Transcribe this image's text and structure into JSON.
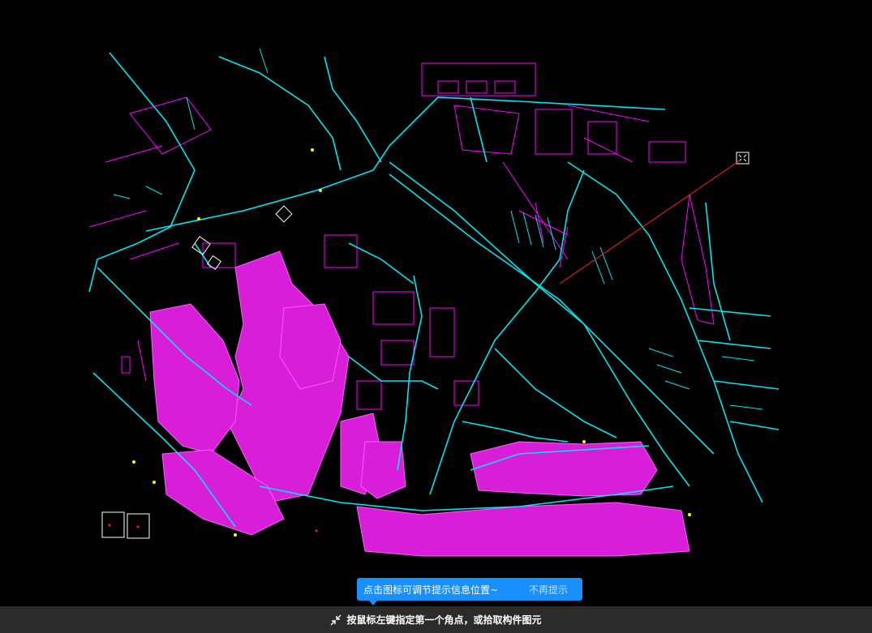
{
  "tooltip": {
    "message": "点击图标可调节提示信息位置~",
    "dismiss_label": "不再提示"
  },
  "status_bar": {
    "prompt": "按鼠标左键指定第一个角点，或拾取构件图元",
    "icon": "collapse-arrows-icon"
  },
  "colors": {
    "background": "#000000",
    "road_lines": "#00e5ee",
    "building_lines": "#ff00ff",
    "tooltip_bg": "#1890ff",
    "status_bg": "#2b2b2b",
    "rubber_band": "#ff2020",
    "markers": "#ffffff"
  }
}
